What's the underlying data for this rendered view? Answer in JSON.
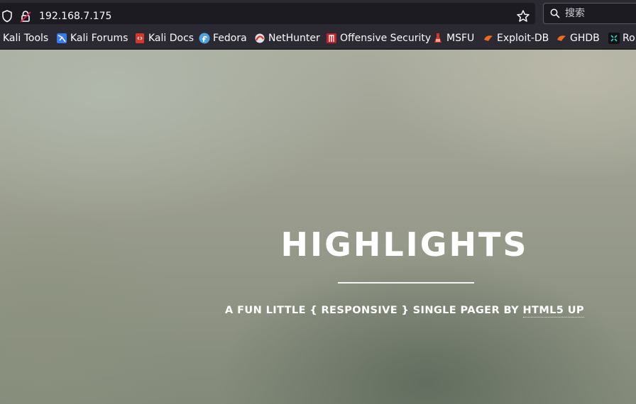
{
  "browser": {
    "url": "192.168.7.175",
    "search_placeholder": "搜索"
  },
  "bookmarks": [
    {
      "label": "Kali Tools",
      "icon": "kali-icon"
    },
    {
      "label": "Kali Forums",
      "icon": "kali-forums-icon"
    },
    {
      "label": "Kali Docs",
      "icon": "kali-docs-icon"
    },
    {
      "label": "Fedora",
      "icon": "fedora-icon"
    },
    {
      "label": "NetHunter",
      "icon": "nethunter-icon"
    },
    {
      "label": "Offensive Security",
      "icon": "offsec-icon"
    },
    {
      "label": "MSFU",
      "icon": "msfu-icon"
    },
    {
      "label": "Exploit-DB",
      "icon": "exploit-db-icon"
    },
    {
      "label": "GHDB",
      "icon": "ghdb-icon"
    },
    {
      "label": "Ro",
      "icon": "roadmap-icon"
    }
  ],
  "hero": {
    "title": "HIGHLIGHTS",
    "subtitle_prefix": "A FUN LITTLE { RESPONSIVE } SINGLE PAGER BY ",
    "subtitle_link": "HTML5 UP"
  },
  "colors": {
    "toolbar_bg": "#2b2a33",
    "urlbar_bg": "#1c1b22",
    "text": "#fbfbfe",
    "hero_text": "#ffffff"
  }
}
